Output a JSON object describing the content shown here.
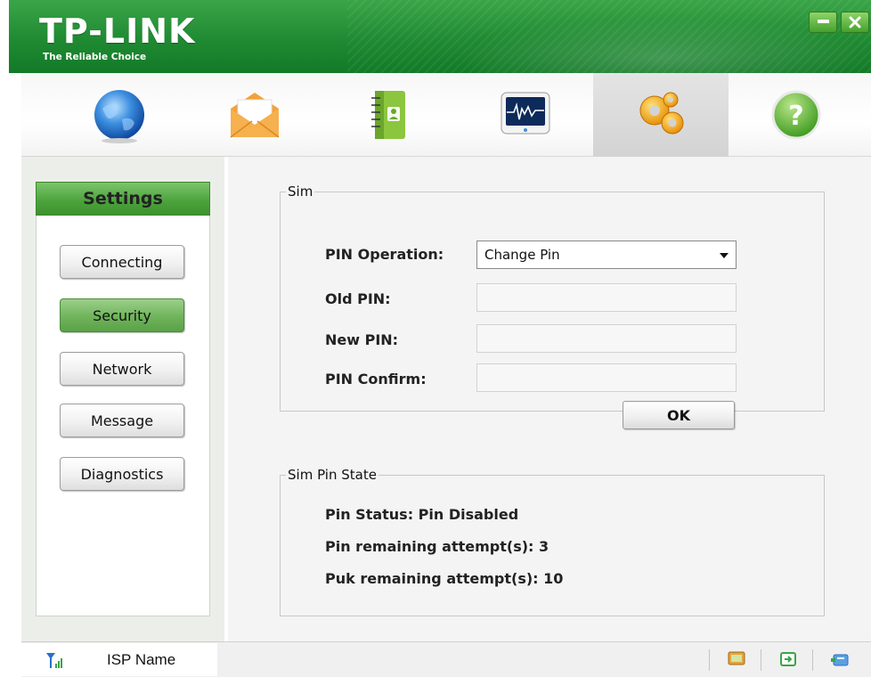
{
  "header": {
    "logo_text": "TP-LINK",
    "tagline": "The Reliable Choice",
    "minimize_icon": "minimize-icon",
    "close_icon": "close-icon",
    "brand_color": "#1f8a32"
  },
  "toolbar": {
    "items": [
      {
        "icon": "globe-icon",
        "active": false
      },
      {
        "icon": "envelope-icon",
        "active": false
      },
      {
        "icon": "contacts-book-icon",
        "active": false
      },
      {
        "icon": "monitor-waveform-icon",
        "active": false
      },
      {
        "icon": "gears-icon",
        "active": true
      },
      {
        "icon": "help-icon",
        "active": false
      }
    ]
  },
  "sidebar": {
    "title": "Settings",
    "items": [
      {
        "label": "Connecting",
        "active": false
      },
      {
        "label": "Security",
        "active": true
      },
      {
        "label": "Network",
        "active": false
      },
      {
        "label": "Message",
        "active": false
      },
      {
        "label": "Diagnostics",
        "active": false
      }
    ]
  },
  "sim": {
    "legend": "Sim",
    "pin_operation_label": "PIN Operation:",
    "pin_operation_value": "Change Pin",
    "old_pin_label": "Old PIN:",
    "old_pin_value": "",
    "new_pin_label": "New PIN:",
    "new_pin_value": "",
    "pin_confirm_label": "PIN Confirm:",
    "pin_confirm_value": "",
    "ok_label": "OK"
  },
  "sim_state": {
    "legend": "Sim Pin State",
    "pin_status": "Pin Status: Pin Disabled",
    "pin_remaining": "Pin remaining attempt(s): 3",
    "puk_remaining": "Puk remaining attempt(s): 10"
  },
  "statusbar": {
    "signal_icon": "signal-icon",
    "isp_name": "ISP Name",
    "icons": [
      "sms-icon",
      "connection-icon",
      "device-icon"
    ]
  }
}
